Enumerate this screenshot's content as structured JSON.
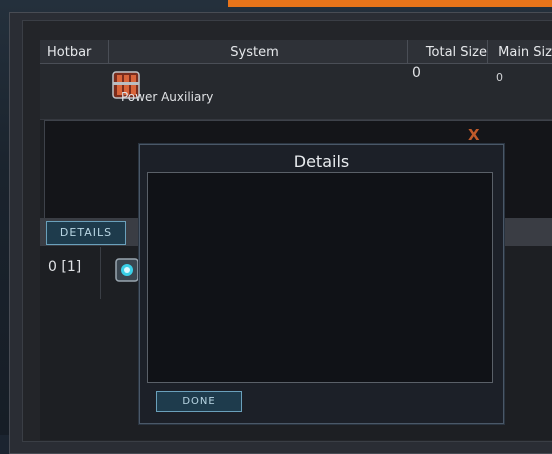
{
  "table": {
    "columns": [
      "Hotbar",
      "System",
      "Total Size",
      "Main Size"
    ],
    "power_row": {
      "name": "Power Auxiliary",
      "total_size": "0",
      "main_size": "0",
      "icon": "power-auxiliary-icon"
    },
    "ship_row": {
      "hotbar": "0 [1]",
      "icon": "ship-core-icon"
    }
  },
  "panel": {
    "close_label": "X",
    "details_button": "DETAILS"
  },
  "modal": {
    "title": "Details",
    "done_button": "DONE"
  },
  "colors": {
    "accent_orange": "#e8741a",
    "button_border": "#6aa0bb",
    "close_red": "#c05a2a"
  }
}
